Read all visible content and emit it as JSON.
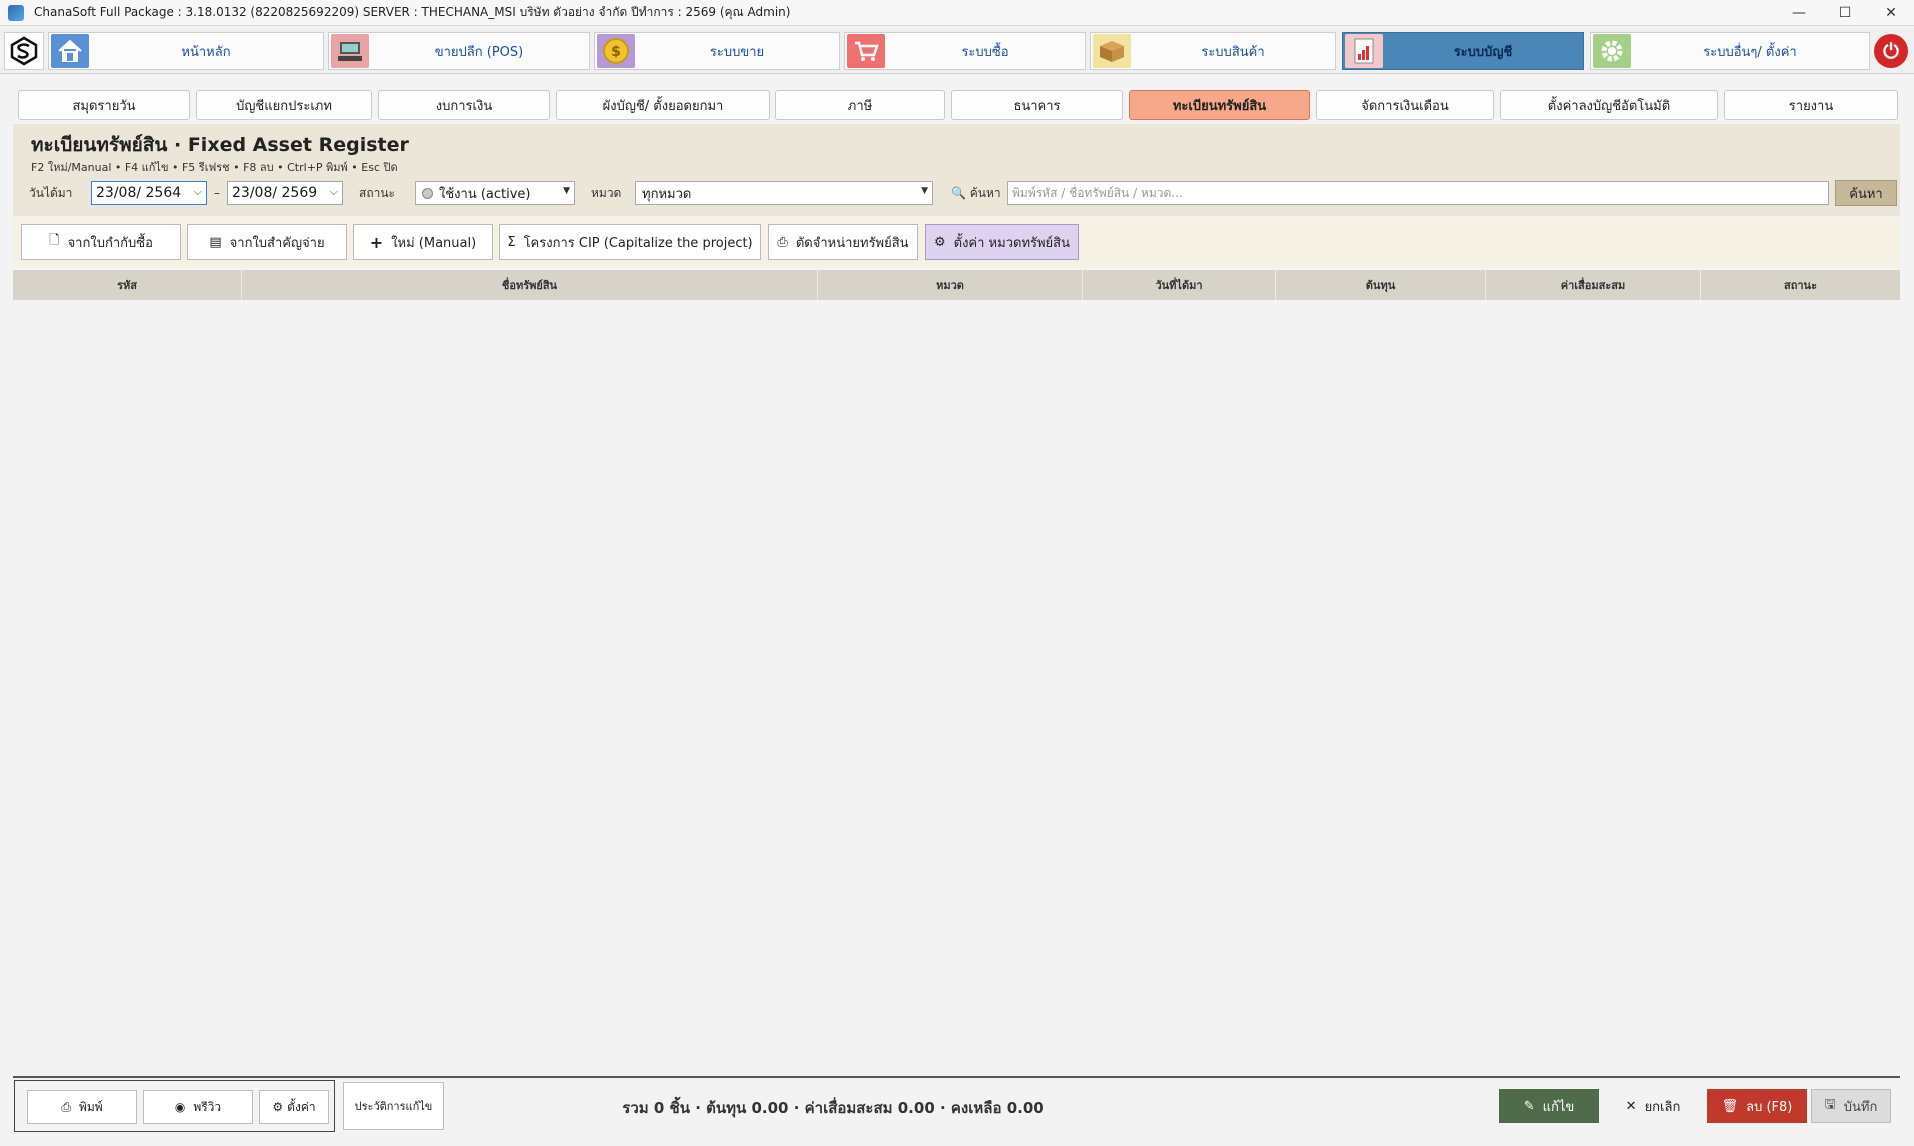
{
  "window": {
    "title": "ChanaSoft Full Package : 3.18.0132 (8220825692209) SERVER : THECHANA_MSI บริษัท ตัวอย่าง จำกัด ปีทำการ : 2569 (คุณ Admin)",
    "minimize": "—",
    "maximize": "☐",
    "close": "✕"
  },
  "modules": [
    {
      "label": "หน้าหลัก",
      "icon": "home-icon",
      "color": "#5b8fd6"
    },
    {
      "label": "ขายปลีก (POS)",
      "icon": "pos-terminal-icon",
      "color": "#e7a5a5"
    },
    {
      "label": "ระบบขาย",
      "icon": "coin-icon",
      "color": "#b49ad8"
    },
    {
      "label": "ระบบซื้อ",
      "icon": "cart-icon",
      "color": "#f07070"
    },
    {
      "label": "ระบบสินค้า",
      "icon": "box-icon",
      "color": "#f3e2a0"
    },
    {
      "label": "ระบบบัญชี",
      "icon": "report-icon",
      "color": "#f3c8c8"
    },
    {
      "label": "ระบบอื่นๆ/ ตั้งค่า",
      "icon": "gear-icon",
      "color": "#a5d08a"
    }
  ],
  "power_label": "⏻",
  "tabs": [
    "สมุดรายวัน",
    "บัญชีแยกประเภท",
    "งบการเงิน",
    "ผังบัญชี/ ตั้งยอดยกมา",
    "ภาษี",
    "ธนาคาร",
    "ทะเบียนทรัพย์สิน",
    "จัดการเงินเดือน",
    "ตั้งค่าลงบัญชีอัตโนมัติ",
    "รายงาน"
  ],
  "active_tab": "ทะเบียนทรัพย์สิน",
  "panel": {
    "title": "ทะเบียนทรัพย์สิน · Fixed Asset Register",
    "hint": "F2 ใหม่/Manual  •  F4 แก้ไข  •  F5 รีเฟรช  •  F8 ลบ  •  Ctrl+P พิมพ์  •  Esc ปิด"
  },
  "filters": {
    "date_label": "วันได้มา",
    "date_from": "23/08/  2564",
    "date_sep": "–",
    "date_to": "23/08/  2569",
    "status_label": "สถานะ",
    "status_value": "ใช้งาน (active)",
    "category_label": "หมวด",
    "category_value": "ทุกหมวด",
    "search_label": "🔍 ค้นหา",
    "search_placeholder": "พิมพ์รหัส / ชื่อทรัพย์สิน / หมวด...",
    "search_button": "ค้นหา"
  },
  "actions": [
    {
      "label": "จากใบกำกับซื้อ",
      "icon": "document-icon",
      "glyph": "🗋"
    },
    {
      "label": "จากใบสำคัญจ่าย",
      "icon": "receipt-icon",
      "glyph": "▤"
    },
    {
      "label": "ใหม่ (Manual)",
      "icon": "plus-icon",
      "glyph": "+"
    },
    {
      "label": "โครงการ CIP (Capitalize the project)",
      "icon": "sigma-icon",
      "glyph": "Σ"
    },
    {
      "label": "ตัดจำหน่ายทรัพย์สิน",
      "icon": "dispose-icon",
      "glyph": "⎙"
    },
    {
      "label": "ตั้งค่า หมวดทรัพย์สิน",
      "icon": "gear-icon",
      "glyph": "⚙"
    }
  ],
  "columns": [
    "รหัส",
    "ชื่อทรัพย์สิน",
    "หมวด",
    "วันที่ได้มา",
    "ต้นทุน",
    "ค่าเสื่อมสะสม",
    "สถานะ"
  ],
  "rows": [],
  "footer": {
    "print": "พิมพ์",
    "preview": "พรีวิว",
    "settings": "ตั้งค่า",
    "history": "ประวัติการแก้ไข",
    "summary": "รวม 0 ชิ้น  ·  ต้นทุน 0.00  ·  ค่าเสื่อมสะสม 0.00  ·  คงเหลือ 0.00",
    "edit": "แก้ไข",
    "cancel": "ยกเลิก",
    "delete": "ลบ (F8)",
    "save": "บันทึก"
  }
}
